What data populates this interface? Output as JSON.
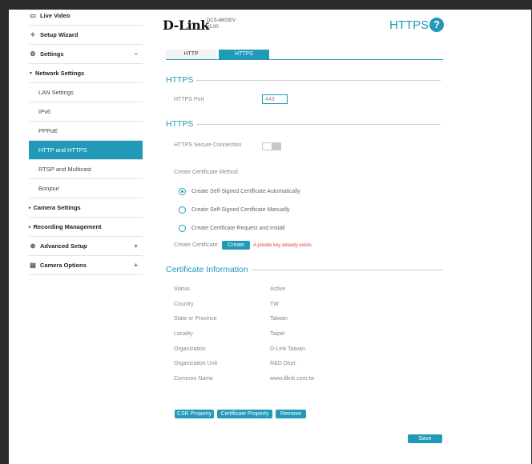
{
  "sidebar": {
    "items": [
      {
        "label": "Live Video",
        "icon": "video-icon"
      },
      {
        "label": "Setup Wizard",
        "icon": "wand-icon"
      },
      {
        "label": "Settings",
        "icon": "gear-icon",
        "toggle": "−"
      },
      {
        "label": "Network Settings",
        "expander": "▼"
      },
      {
        "label": "LAN Settings"
      },
      {
        "label": "IPv6"
      },
      {
        "label": "PPPoE"
      },
      {
        "label": "HTTP and HTTPS"
      },
      {
        "label": "RTSP and Multicast"
      },
      {
        "label": "Bonjour"
      },
      {
        "label": "Camera Settings",
        "expander": "▸"
      },
      {
        "label": "Recording Management",
        "expander": "▸"
      },
      {
        "label": "Advanced Setup",
        "icon": "advanced-icon",
        "toggle": "+"
      },
      {
        "label": "Camera Options",
        "icon": "camera-options-icon",
        "toggle": "+"
      }
    ]
  },
  "header": {
    "brand": "D-Link",
    "model": "DCS-4602EV",
    "version": "v2.00",
    "title": "HTTPS",
    "help": "?"
  },
  "tabs": {
    "http": "HTTP",
    "https": "HTTPS"
  },
  "https_section": {
    "title": "HTTPS",
    "port_label": "HTTPS Port",
    "port_value": "443"
  },
  "secure_section": {
    "title": "HTTPS",
    "secure_label": "HTTPS Secure Connection",
    "method_label": "Create Certificate Method",
    "options": [
      "Create Self-Signed Certificate Automatically",
      "Create Self-Signed Certificate Manually",
      "Create Certificate Request and Install"
    ],
    "create_label": "Create Certificate:",
    "create_button": "Create",
    "warning": "A private key already exists"
  },
  "cert_info": {
    "title": "Certificate Information",
    "rows": [
      {
        "label": "Status",
        "value": "Active"
      },
      {
        "label": "Country",
        "value": "TW"
      },
      {
        "label": "State or Province",
        "value": "Taiwan"
      },
      {
        "label": "Locality",
        "value": "Taipei"
      },
      {
        "label": "Organization",
        "value": "D-Link Taiwan"
      },
      {
        "label": "Organization Unit",
        "value": "R&D Dept."
      },
      {
        "label": "Common Name",
        "value": "www.dlink.com.tw"
      }
    ]
  },
  "actions": {
    "csr": "CSR Property",
    "cert": "Certificate Property",
    "remove": "Remove",
    "save": "Save"
  },
  "colors": {
    "accent": "#2199b8",
    "warning": "#e03a3a"
  }
}
